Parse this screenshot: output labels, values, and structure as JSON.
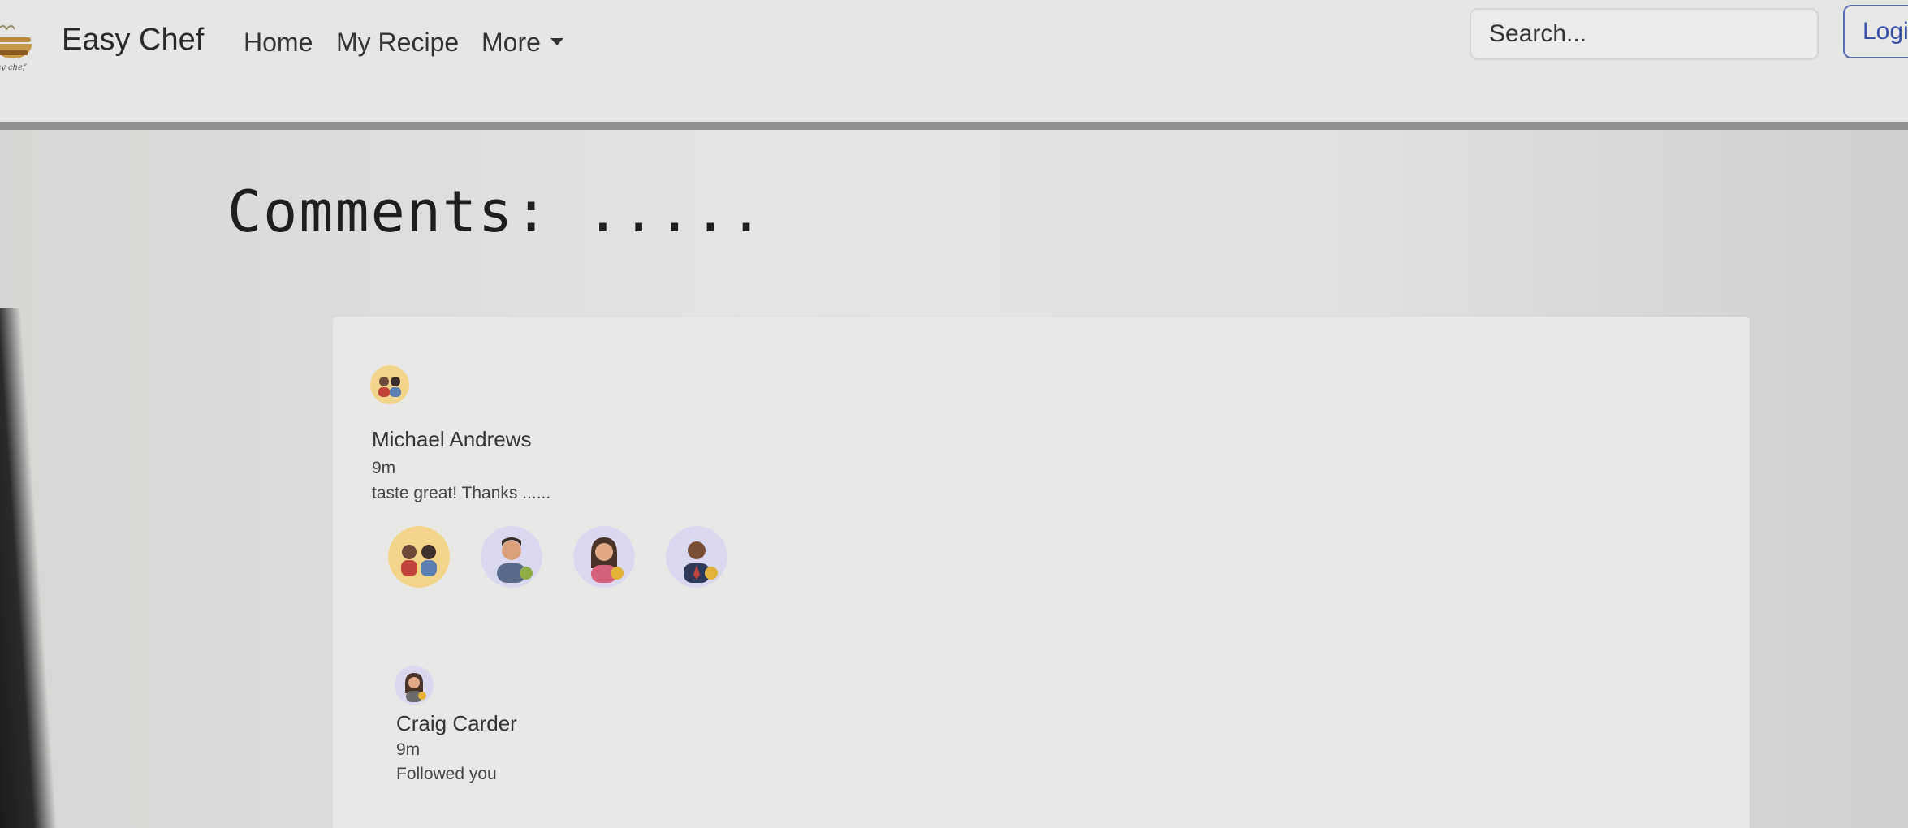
{
  "navbar": {
    "brand": "Easy Chef",
    "links": [
      "Home",
      "My Recipe",
      "More"
    ],
    "search_placeholder": "Search...",
    "login_label": "Login"
  },
  "comments": {
    "heading": "Comments: .....",
    "items": [
      {
        "name": "Michael Andrews",
        "time": "9m",
        "text": "taste great! Thanks ......"
      },
      {
        "name": "Craig Carder",
        "time": "9m",
        "text": "Followed you"
      }
    ]
  },
  "colors": {
    "accent": "#3a50a8",
    "navbar_border": "#8f8f8f",
    "avatar_yellow": "#f2d48a",
    "avatar_lavender": "#d9d8ef"
  },
  "icons": [
    "chef-bowl-logo",
    "group-avatar",
    "man-avatar",
    "woman-avatar",
    "businessman-avatar"
  ]
}
